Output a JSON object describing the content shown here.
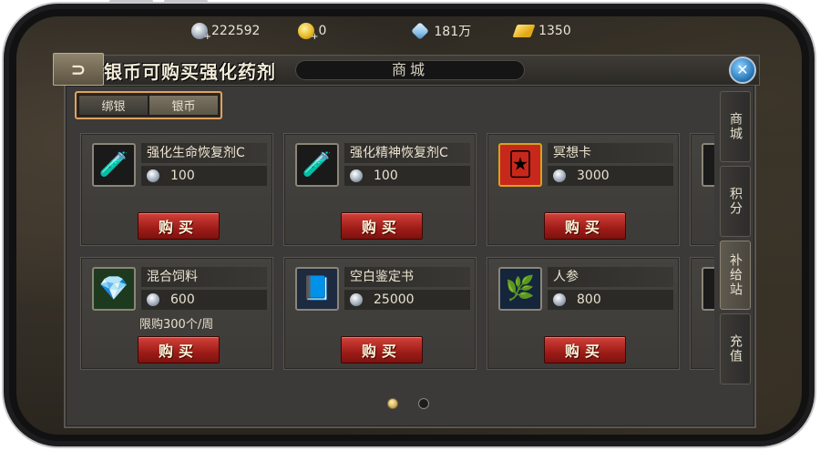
{
  "currency": [
    {
      "icon": "silver-coin-icon",
      "value": "222592"
    },
    {
      "icon": "gold-coin-icon",
      "value": "0"
    },
    {
      "icon": "diamond-icon",
      "value": "181万"
    },
    {
      "icon": "ticket-icon",
      "value": "1350"
    }
  ],
  "header": {
    "back_label": "⊃",
    "title": "银币可购买强化药剂",
    "shop_title": "商城",
    "close_label": "✕"
  },
  "subtabs": [
    {
      "label": "绑银",
      "active": false
    },
    {
      "label": "银币",
      "active": true
    }
  ],
  "right_tabs": [
    {
      "label": "商城",
      "active": false
    },
    {
      "label": "积分",
      "active": false
    },
    {
      "label": "补给站",
      "active": true
    },
    {
      "label": "充值",
      "active": false
    }
  ],
  "items": [
    {
      "name": "强化生命恢复剂C",
      "price": "100",
      "buy": "购买",
      "icon": "red-potion-icon",
      "glyph": "🧪",
      "limit": ""
    },
    {
      "name": "强化精神恢复剂C",
      "price": "100",
      "buy": "购买",
      "icon": "blue-potion-icon",
      "glyph": "🧪",
      "limit": ""
    },
    {
      "name": "冥想卡",
      "price": "3000",
      "buy": "购买",
      "icon": "meditation-card-icon",
      "glyph": "🃏",
      "limit": ""
    },
    {
      "name": "混合饲料",
      "price": "600",
      "buy": "购买",
      "icon": "green-crystal-icon",
      "glyph": "💎",
      "limit": "限购300个/周"
    },
    {
      "name": "空白鉴定书",
      "price": "25000",
      "buy": "购买",
      "icon": "blank-book-icon",
      "glyph": "📘",
      "limit": ""
    },
    {
      "name": "人参",
      "price": "800",
      "buy": "购买",
      "icon": "ginseng-icon",
      "glyph": "🌿",
      "limit": ""
    }
  ],
  "pagination": {
    "pages": 2,
    "current": 1
  }
}
